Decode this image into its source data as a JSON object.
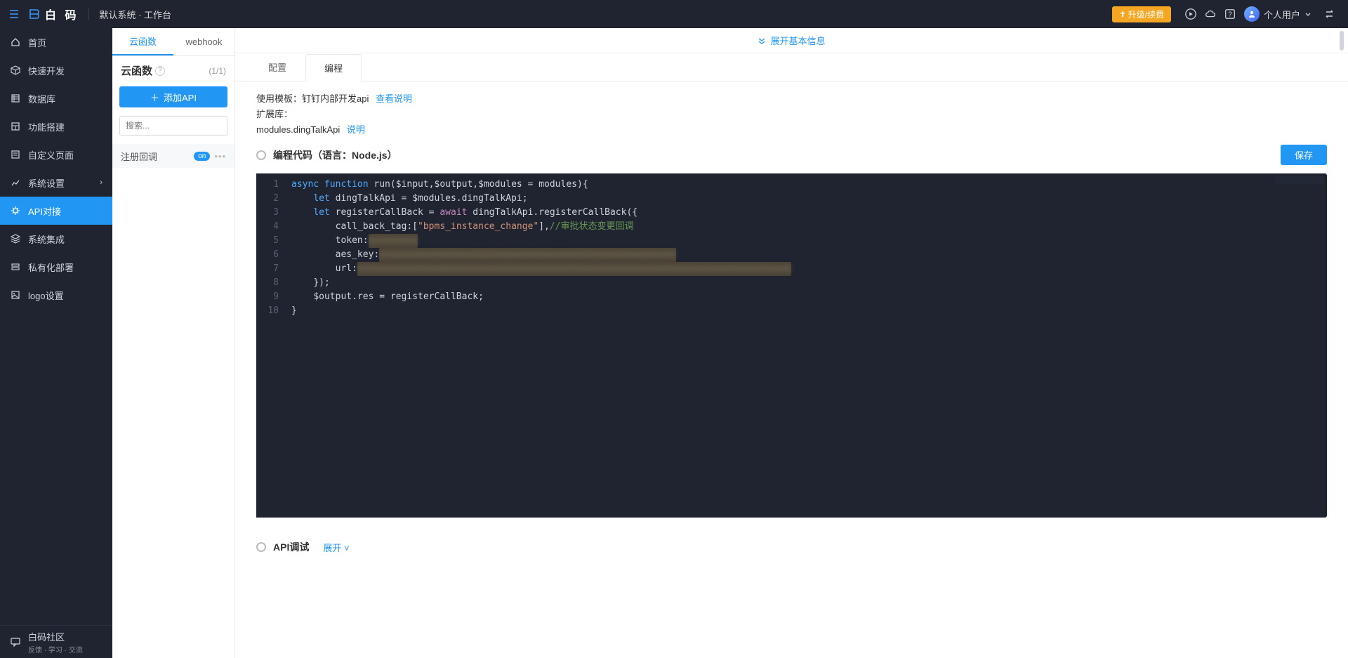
{
  "header": {
    "brand": "白   码",
    "breadcrumb": "默认系统 · 工作台",
    "upgrade": "升级/续费",
    "username": "个人用户"
  },
  "sidebar": {
    "items": [
      {
        "label": "首页"
      },
      {
        "label": "快速开发"
      },
      {
        "label": "数据库"
      },
      {
        "label": "功能搭建"
      },
      {
        "label": "自定义页面"
      },
      {
        "label": "系统设置",
        "hasArrow": true
      },
      {
        "label": "API对接",
        "active": true
      },
      {
        "label": "系统集成"
      },
      {
        "label": "私有化部署"
      },
      {
        "label": "logo设置"
      }
    ],
    "community": {
      "title": "白码社区",
      "sub": "反馈 · 学习 · 交流"
    }
  },
  "panel": {
    "tabs": [
      "云函数",
      "webhook"
    ],
    "title": "云函数",
    "count": "(1/1)",
    "addBtn": "添加API",
    "searchPlaceholder": "搜索...",
    "items": [
      {
        "label": "注册回调",
        "badge": "on"
      }
    ]
  },
  "content": {
    "expandInfo": "展开基本信息",
    "tabs": [
      "配置",
      "编程"
    ],
    "template_prefix": "使用模板：",
    "template_name": "钉钉内部开发api",
    "template_link": "查看说明",
    "ext_lib": "扩展库：",
    "module_name": "modules.dingTalkApi",
    "module_link": "说明",
    "code_title": "编程代码（语言：Node.js）",
    "save": "保存",
    "code": {
      "lines": 10,
      "l1_a": "async function",
      "l1_b": " run($input,$output,$modules = modules){",
      "l2_a": "let",
      "l2_b": " dingTalkApi = $modules.dingTalkApi;",
      "l3_a": "let",
      "l3_b": " registerCallBack = ",
      "l3_c": "await",
      "l3_d": " dingTalkApi.registerCallBack({",
      "l4_a": "call_back_tag:[",
      "l4_b": "\"bpms_instance_change\"",
      "l4_c": "],",
      "l4_d": "//审批状态变更回调",
      "l5": "token:",
      "l6": "aes_key:",
      "l7": "url:",
      "l8": "});",
      "l9": "$output.res = registerCallBack;",
      "l10": "}"
    },
    "debug_title": "API调试",
    "debug_link": "展开 ˅"
  }
}
